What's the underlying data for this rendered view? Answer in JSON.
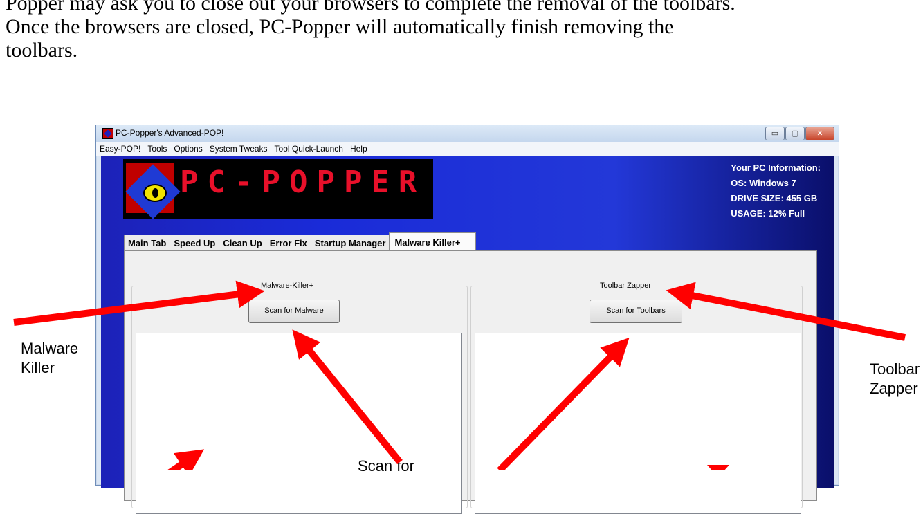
{
  "document": {
    "lines": [
      "Popper may ask you to close out your browsers to complete the removal of the toolbars.",
      "Once the browsers are closed, PC-Popper will automatically finish removing the",
      "toolbars."
    ]
  },
  "window": {
    "title": "PC-Popper's Advanced-POP!",
    "controls": {
      "minimize": "▭",
      "maximize": "▢",
      "close": "✕"
    }
  },
  "menu": [
    "Easy-POP!",
    "Tools",
    "Options",
    "System Tweaks",
    "Tool Quick-Launch",
    "Help"
  ],
  "logo": {
    "text": "PC-POPPER"
  },
  "pc_info": {
    "heading": "Your PC Information:",
    "os": "OS: Windows 7",
    "drive": "DRIVE SIZE: 455 GB",
    "usage": "USAGE: 12% Full"
  },
  "tabs": [
    "Main Tab",
    "Speed Up",
    "Clean Up",
    "Error Fix",
    "Startup Manager",
    "Malware Killer+"
  ],
  "active_tab": "Malware Killer+",
  "groups": {
    "malware": {
      "title": "Malware-Killer+",
      "button": "Scan for Malware"
    },
    "toolbar": {
      "title": "Toolbar Zapper",
      "button": "Scan for Toolbars"
    }
  },
  "callouts": {
    "malware_killer": [
      "Malware",
      "Killer"
    ],
    "toolbar_zapper": [
      "Toolbar",
      "Zapper"
    ],
    "scan_for": "Scan for"
  },
  "colors": {
    "arrow": "#ff0000",
    "logo_text": "#e8102a",
    "client_bg": "#1c22b8"
  }
}
